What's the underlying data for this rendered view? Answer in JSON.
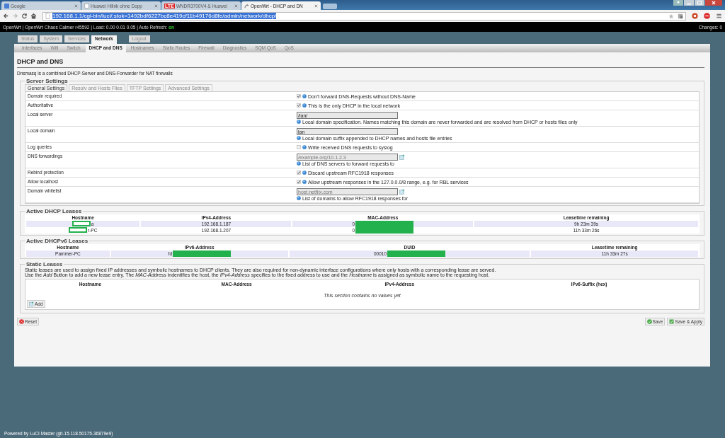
{
  "browser": {
    "tabs": [
      {
        "title": "Google",
        "selected": false,
        "kind": "g"
      },
      {
        "title": "Huawei Hilink ohne Dopp",
        "selected": false,
        "kind": "page"
      },
      {
        "title": "WNDR3700V4 & Huawei",
        "selected": false,
        "kind": "lte",
        "badge": "LTE"
      },
      {
        "title": "OpenWrt - DHCP and DN",
        "selected": true,
        "kind": "wrt"
      }
    ],
    "url": "192.168.1.1/cgi-bin/luci/;stok=1492bdf6227bc8e419cf11b49176d8fe/admin/network/dhcp/"
  },
  "header": {
    "info": "OpenWrt | OpenWrt Chaos Calmer r45592 | Load: 0.00 0.01 0.05 | Auto Refresh:",
    "auto_refresh": "on",
    "changes": "Changes: 0"
  },
  "menu": [
    {
      "label": "Status",
      "selected": false,
      "kind": "item"
    },
    {
      "label": "System",
      "selected": false,
      "kind": "item"
    },
    {
      "label": "Services",
      "selected": false,
      "kind": "item"
    },
    {
      "label": "Network",
      "selected": true,
      "kind": "item"
    },
    {
      "label": "Logout",
      "selected": false,
      "kind": "logout"
    }
  ],
  "submenu": [
    {
      "label": "Interfaces",
      "selected": false
    },
    {
      "label": "Wifi",
      "selected": false
    },
    {
      "label": "Switch",
      "selected": false
    },
    {
      "label": "DHCP and DNS",
      "selected": true
    },
    {
      "label": "Hostnames",
      "selected": false
    },
    {
      "label": "Static Routes",
      "selected": false
    },
    {
      "label": "Firewall",
      "selected": false
    },
    {
      "label": "Diagnostics",
      "selected": false
    },
    {
      "label": "SQM QoS",
      "selected": false
    },
    {
      "label": "QoS",
      "selected": false
    }
  ],
  "page": {
    "title": "DHCP and DNS",
    "description": "Dnsmasq is a combined DHCP-Server and DNS-Forwarder for NAT firewalls"
  },
  "server_settings": {
    "legend": "Server Settings",
    "tabs": [
      {
        "label": "General Settings",
        "selected": true
      },
      {
        "label": "Resolv and Hosts Files",
        "selected": false
      },
      {
        "label": "TFTP Settings",
        "selected": false
      },
      {
        "label": "Advanced Settings",
        "selected": false
      }
    ],
    "rows": [
      {
        "label": "Domain required",
        "kind": "checkbox",
        "checked": true,
        "description": "Don't forward DNS-Requests without DNS-Name"
      },
      {
        "label": "Authoritative",
        "kind": "checkbox",
        "checked": true,
        "description": "This is the only DHCP in the local network"
      },
      {
        "label": "Local server",
        "kind": "text",
        "value": "/lan/",
        "description": "Local domain specification. Names matching this domain are never forwarded and are resolved from DHCP or hosts files only"
      },
      {
        "label": "Local domain",
        "kind": "text",
        "value": "lan",
        "description": "Local domain suffix appended to DHCP names and hosts file entries"
      },
      {
        "label": "Log queries",
        "kind": "checkbox",
        "checked": false,
        "description": "Write received DNS requests to syslog"
      },
      {
        "label": "DNS forwardings",
        "kind": "list",
        "placeholder": "/example.org/10.1.2.3",
        "description": "List of DNS servers to forward requests to"
      },
      {
        "label": "Rebind protection",
        "kind": "checkbox",
        "checked": true,
        "description": "Discard upstream RFC1918 responses"
      },
      {
        "label": "Allow localhost",
        "kind": "checkbox",
        "checked": true,
        "description": "Allow upstream responses in the 127.0.0.0/8 range, e.g. for RBL services"
      },
      {
        "label": "Domain whitelist",
        "kind": "list",
        "placeholder": "host.netflix.com",
        "description": "List of domains to allow RFC1918 responses for"
      }
    ]
  },
  "dhcp_leases": {
    "legend": "Active DHCP Leases",
    "columns": [
      "Hostname",
      "IPv4-Address",
      "MAC-Address",
      "Leasetime remaining"
    ],
    "rows": [
      {
        "cells": [
          {
            "text": "a",
            "masked_before": true
          },
          {
            "text": "192.168.1.187"
          },
          {
            "text": "0",
            "masked_after": true
          },
          {
            "text": "9h 23m 39s"
          }
        ]
      },
      {
        "cells": [
          {
            "text": "r-PC",
            "masked_before": true
          },
          {
            "text": "192.168.1.207"
          },
          {
            "text": "0",
            "masked_after": true
          },
          {
            "text": "11h 33m 26s"
          }
        ]
      }
    ]
  },
  "dhcpv6_leases": {
    "legend": "Active DHCPv6 Leases",
    "columns": [
      "Hostname",
      "IPv6-Address",
      "DUID",
      "Leasetime remaining"
    ],
    "rows": [
      {
        "cells": [
          {
            "text": "Pammer-PC"
          },
          {
            "text": "fd",
            "masked_after": true
          },
          {
            "text": "00010",
            "masked_after": true
          },
          {
            "text": "11h 33m 27s"
          }
        ]
      }
    ]
  },
  "static_leases": {
    "legend": "Static Leases",
    "description": [
      "Static leases are used to assign fixed IP addresses and symbolic hostnames to DHCP clients. They are also required for non-dynamic interface configurations where only hosts with a corresponding lease are served.",
      "Use the *Add* Button to add a new lease entry. The *MAC-Address* indentifies the host, the *IPv4-Address* specifies to the fixed address to use and the *Hostname* is assigned as symbolic name to the requesting host."
    ],
    "columns": [
      "Hostname",
      "MAC-Address",
      "IPv4-Address",
      "IPv6-Suffix (hex)"
    ],
    "empty": "This section contains no values yet",
    "add": "Add"
  },
  "actions": {
    "reset": "Reset",
    "save": "Save",
    "save_apply": "Save & Apply"
  },
  "footer": "Powered by LuCI Master (git-15.118.50175-36879e9)"
}
